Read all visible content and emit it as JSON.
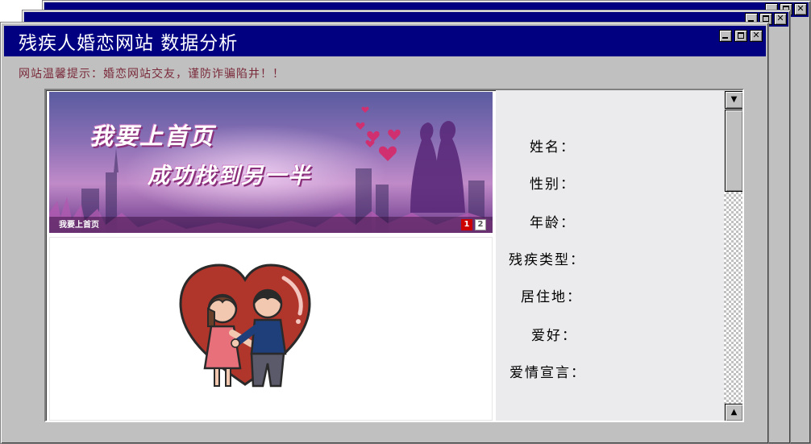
{
  "window": {
    "title": "残疾人婚恋网站 数据分析",
    "controls": {
      "minimize": "",
      "maximize": "",
      "close": "✕"
    }
  },
  "notice": "网站温馨提示：婚恋网站交友，谨防诈骗陷井！！",
  "banner": {
    "headline": "我要上首页",
    "tagline": "成功找到另一半",
    "caption": "我要上首页",
    "pages": [
      "1",
      "2"
    ],
    "active_page": "1"
  },
  "profile": {
    "fields": [
      {
        "label": "姓名："
      },
      {
        "label": "性别："
      },
      {
        "label": "年龄："
      },
      {
        "label": "残疾类型："
      },
      {
        "label": "居住地："
      },
      {
        "label": "爱好："
      },
      {
        "label": "爱情宣言："
      }
    ]
  },
  "scrollbar": {
    "up_arrow": "▲",
    "down_arrow": "▼"
  },
  "illustration": {
    "icon": "couple-heart-icon"
  },
  "colors": {
    "titlebar": "#000080",
    "window": "#c0c0c0",
    "notice_text": "#7a2a3a",
    "profile_bg": "#ebebed",
    "pager_active": "#cc0000"
  }
}
